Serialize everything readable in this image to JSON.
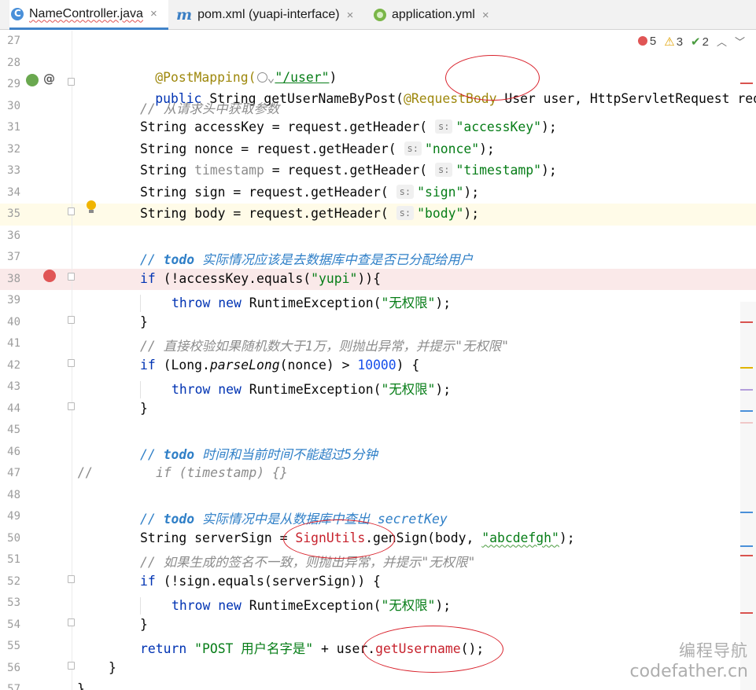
{
  "tabs": [
    {
      "label": "NameController.java",
      "icon": "java-class-icon",
      "active": true
    },
    {
      "label": "pom.xml (yuapi-interface)",
      "icon": "maven-icon",
      "active": false
    },
    {
      "label": "application.yml",
      "icon": "spring-yml-icon",
      "active": false
    }
  ],
  "close_glyph": "×",
  "inspections": {
    "errors": "5",
    "warnings": "3",
    "weak_warnings": "2"
  },
  "line_numbers": [
    "27",
    "28",
    "29",
    "30",
    "31",
    "32",
    "33",
    "34",
    "35",
    "36",
    "37",
    "38",
    "39",
    "40",
    "41",
    "42",
    "43",
    "44",
    "45",
    "46",
    "47",
    "48",
    "49",
    "50",
    "51",
    "52",
    "53",
    "54",
    "55",
    "56",
    "57"
  ],
  "code": {
    "l28": {
      "annotation": "@PostMapping(",
      "path": "\"/user\"",
      "close": ")"
    },
    "l29": {
      "public": "public",
      "type": "String",
      "method": "getUserNameByPost(",
      "annotation": "@RequestBody",
      "param": "User user, HttpServletRequest request"
    },
    "l30": "// 从请求头中获取参数",
    "l31": {
      "decl": "String accessKey = request.getHeader(",
      "hint": "s:",
      "arg": "\"accessKey\"",
      "tail": ");"
    },
    "l32": {
      "decl": "String nonce = request.getHeader(",
      "hint": "s:",
      "arg": "\"nonce\"",
      "tail": ");"
    },
    "l33": {
      "type": "String",
      "var": "timestamp",
      "decl": " = request.getHeader(",
      "hint": "s:",
      "arg": "\"timestamp\"",
      "tail": ");"
    },
    "l34": {
      "decl": "String sign = request.getHeader(",
      "hint": "s:",
      "arg": "\"sign\"",
      "tail": ");"
    },
    "l35": {
      "decl": "String body = request.getHeader(",
      "hint": "s:",
      "arg": "\"body\"",
      "tail": ");"
    },
    "l37": {
      "slashes": "// ",
      "todo": "todo",
      "text": " 实际情况应该是去数据库中查是否已分配给用户"
    },
    "l38": {
      "kw": "if",
      "pre": " (!accessKey.equals(",
      "arg": "\"yupi\"",
      "tail": ")){"
    },
    "l39": {
      "throw": "throw",
      "new": "new",
      "exc": " RuntimeException(",
      "arg": "\"无权限\"",
      "tail": ");"
    },
    "l40": "}",
    "l41": "// 直接校验如果随机数大于1万，则抛出异常，并提示\"无权限\"",
    "l42": {
      "kw": "if",
      "pre": " (Long.",
      "method": "parseLong",
      "mid": "(nonce) > ",
      "num": "10000",
      "tail": ") {"
    },
    "l43": {
      "throw": "throw",
      "new": "new",
      "exc": " RuntimeException(",
      "arg": "\"无权限\"",
      "tail": ");"
    },
    "l44": "}",
    "l46": {
      "slashes": "// ",
      "todo": "todo",
      "text": " 时间和当前时间不能超过5分钟"
    },
    "l47": {
      "slashes": "//",
      "text": "if (timestamp) {}"
    },
    "l49": {
      "slashes": "// ",
      "todo": "todo",
      "text": " 实际情况中是从数据库中查出 secretKey"
    },
    "l50": {
      "pre": "String serverSign = ",
      "cls": "SignUtils",
      "mid": ".genSign(body, ",
      "arg": "\"abcdefgh\"",
      "tail": ");"
    },
    "l51": "// 如果生成的签名不一致，则抛出异常，并提示\"无权限\"",
    "l52": {
      "kw": "if",
      "pre": " (!sign.equals(serverSign)) {"
    },
    "l53": {
      "throw": "throw",
      "new": "new",
      "exc": " RuntimeException(",
      "arg": "\"无权限\"",
      "tail": ");"
    },
    "l54": "}",
    "l55": {
      "kw": "return",
      "str": " \"POST 用户名字是\"",
      "mid": " + user.",
      "method": "getUsername",
      "tail": "();"
    },
    "l56": "}",
    "l57": "}"
  },
  "watermark": {
    "line1": "编程导航",
    "line2": "codefather.cn"
  },
  "colors": {
    "keyword": "#0033b3",
    "string": "#067d17",
    "annotation": "#9e880d",
    "comment": "#8c8c8c",
    "todo": "#2f7fc7",
    "number": "#1750eb",
    "highlight_oval": "#d9232d",
    "caret_line": "#fffbe8",
    "breakpoint_line": "#fae9e9"
  }
}
